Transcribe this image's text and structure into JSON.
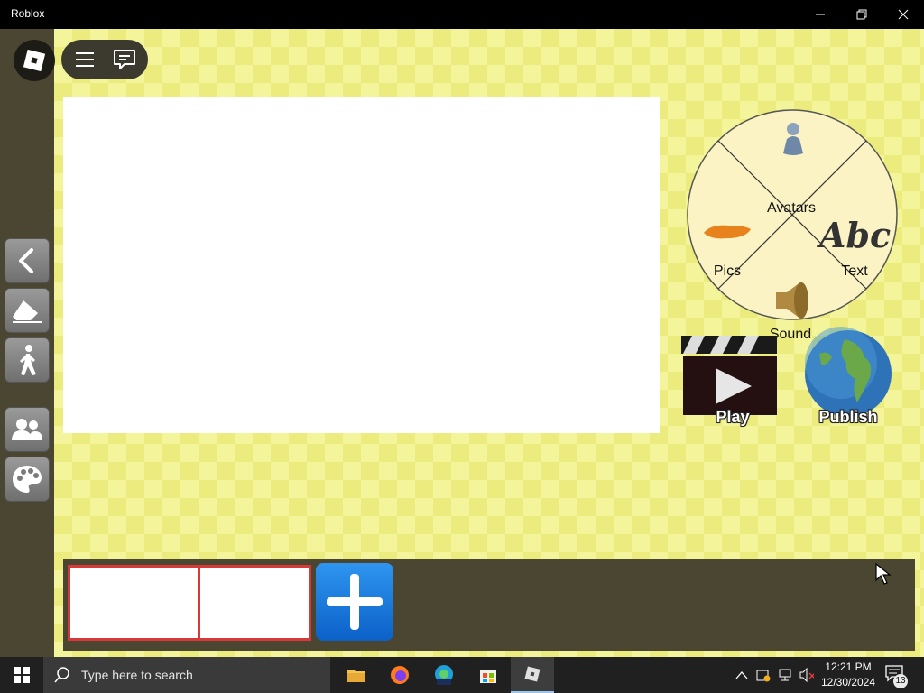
{
  "window": {
    "title": "Roblox"
  },
  "menu": {
    "items": [
      "menu-icon",
      "chat-icon"
    ]
  },
  "tools": [
    {
      "name": "back-button",
      "icon": "arrow-left-icon"
    },
    {
      "name": "eraser-button",
      "icon": "eraser-icon"
    },
    {
      "name": "animate-button",
      "icon": "walking-person-icon"
    },
    {
      "name": "players-button",
      "icon": "people-icon"
    },
    {
      "name": "palette-button",
      "icon": "palette-icon"
    }
  ],
  "wheel": {
    "avatars": "Avatars",
    "text": "Text",
    "pics": "Pics",
    "sound": "Sound",
    "abc_glyph": "Abc"
  },
  "actions": {
    "play": "Play",
    "publish": "Publish"
  },
  "frames": {
    "count": 2
  },
  "taskbar": {
    "search_placeholder": "Type here to search",
    "apps": [
      "file-explorer-icon",
      "firefox-icon",
      "edge-beta-icon",
      "microsoft-store-icon",
      "roblox-icon"
    ],
    "active_app": "roblox-icon",
    "time": "12:21 PM",
    "date": "12/30/2024",
    "notification_count": "13"
  },
  "colors": {
    "canvas_yellow": "#f4f49a",
    "sidebar": "#4a4632",
    "frame_border": "#d93838",
    "add_button": "#1877dc"
  }
}
